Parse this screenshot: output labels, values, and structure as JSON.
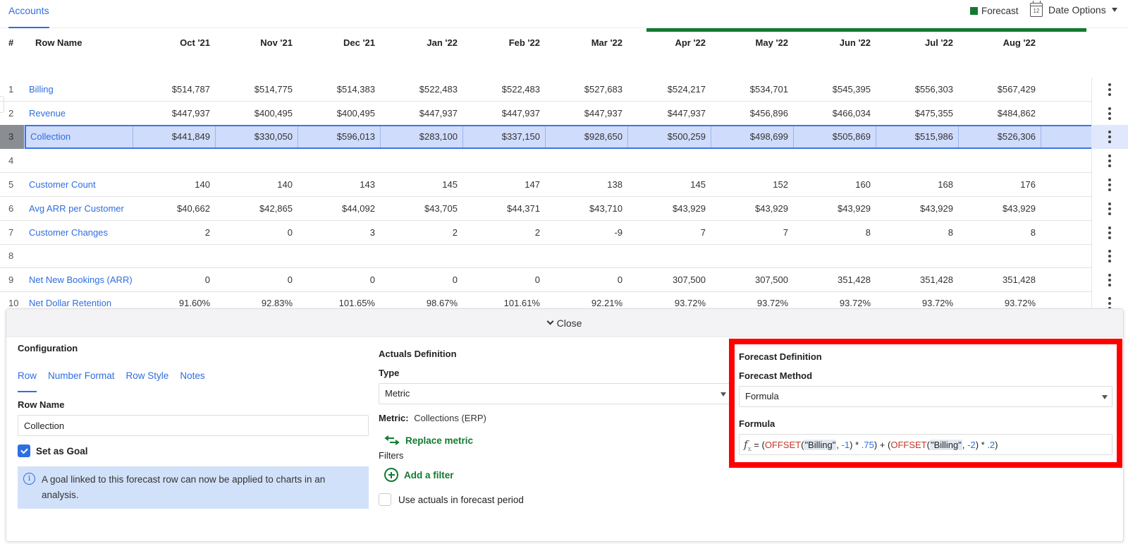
{
  "topbar": {
    "active_tab": "Accounts",
    "legend_label": "Forecast",
    "legend_color": "#117a2f",
    "date_options_label": "Date Options",
    "calendar_day": "12"
  },
  "table": {
    "headers": {
      "index": "#",
      "row_name": "Row Name",
      "months": [
        "Oct '21",
        "Nov '21",
        "Dec '21",
        "Jan '22",
        "Feb '22",
        "Mar '22",
        "Apr '22",
        "May '22",
        "Jun '22",
        "Jul '22",
        "Aug '22"
      ]
    },
    "forecast_start_month": "Apr '22",
    "rows": [
      {
        "index": "1",
        "name": "Billing",
        "values": [
          "$514,787",
          "$514,775",
          "$514,383",
          "$522,483",
          "$522,483",
          "$527,683",
          "$524,217",
          "$534,701",
          "$545,395",
          "$556,303",
          "$567,429"
        ]
      },
      {
        "index": "2",
        "name": "Revenue",
        "values": [
          "$447,937",
          "$400,495",
          "$400,495",
          "$447,937",
          "$447,937",
          "$447,937",
          "$447,937",
          "$456,896",
          "$466,034",
          "$475,355",
          "$484,862"
        ]
      },
      {
        "index": "3",
        "name": "Collection",
        "selected": true,
        "values": [
          "$441,849",
          "$330,050",
          "$596,013",
          "$283,100",
          "$337,150",
          "$928,650",
          "$500,259",
          "$498,699",
          "$505,869",
          "$515,986",
          "$526,306"
        ]
      },
      {
        "index": "4",
        "name": "",
        "values": [
          "",
          "",
          "",
          "",
          "",
          "",
          "",
          "",
          "",
          "",
          ""
        ]
      },
      {
        "index": "5",
        "name": "Customer Count",
        "values": [
          "140",
          "140",
          "143",
          "145",
          "147",
          "138",
          "145",
          "152",
          "160",
          "168",
          "176"
        ]
      },
      {
        "index": "6",
        "name": "Avg ARR per Customer",
        "values": [
          "$40,662",
          "$42,865",
          "$44,092",
          "$43,705",
          "$44,371",
          "$43,710",
          "$43,929",
          "$43,929",
          "$43,929",
          "$43,929",
          "$43,929"
        ]
      },
      {
        "index": "7",
        "name": "Customer Changes",
        "values": [
          "2",
          "0",
          "3",
          "2",
          "2",
          "-9",
          "7",
          "7",
          "8",
          "8",
          "8"
        ]
      },
      {
        "index": "8",
        "name": "",
        "values": [
          "",
          "",
          "",
          "",
          "",
          "",
          "",
          "",
          "",
          "",
          ""
        ]
      },
      {
        "index": "9",
        "name": "Net New Bookings (ARR)",
        "values": [
          "0",
          "0",
          "0",
          "0",
          "0",
          "0",
          "307,500",
          "307,500",
          "351,428",
          "351,428",
          "351,428"
        ]
      },
      {
        "index": "10",
        "name": "Net Dollar Retention",
        "values": [
          "91.60%",
          "92.83%",
          "101.65%",
          "98.67%",
          "101.61%",
          "92.21%",
          "93.72%",
          "93.72%",
          "93.72%",
          "93.72%",
          "93.72%"
        ]
      }
    ]
  },
  "drawer": {
    "close_label": "Close",
    "configuration": {
      "title": "Configuration",
      "tabs": [
        "Row",
        "Number Format",
        "Row Style",
        "Notes"
      ],
      "active_tab": "Row",
      "row_name_label": "Row Name",
      "row_name_value": "Collection",
      "set_as_goal_label": "Set as Goal",
      "set_as_goal_checked": true,
      "info_text": "A goal linked to this forecast row can now be applied to charts in an analysis."
    },
    "actuals": {
      "title": "Actuals Definition",
      "type_label": "Type",
      "type_value": "Metric",
      "metric_label": "Metric:",
      "metric_value": "Collections (ERP)",
      "replace_metric_label": "Replace metric",
      "filters_label": "Filters",
      "add_filter_label": "Add a filter",
      "use_actuals_label": "Use actuals in forecast period",
      "use_actuals_checked": false
    },
    "forecast": {
      "title": "Forecast Definition",
      "method_label": "Forecast Method",
      "method_value": "Formula",
      "formula_label": "Formula",
      "formula_prefix": "= (",
      "formula_tokens": {
        "fn1": "OFFSET",
        "open1": "(",
        "str1": "\"Billing\"",
        "comma1": ", ",
        "num1": "-1",
        "mid1": ") * ",
        "num2": ".75",
        "mid2": ") + (",
        "fn2": "OFFSET",
        "open2": "(",
        "str2": "\"Billing\"",
        "comma2": ", ",
        "num3": "-2",
        "mid3": ") * ",
        "num4": ".2",
        "end": ")"
      },
      "formula_text": "= (OFFSET(\"Billing\", -1) * .75) + (OFFSET(\"Billing\", -2) * .2)"
    }
  }
}
